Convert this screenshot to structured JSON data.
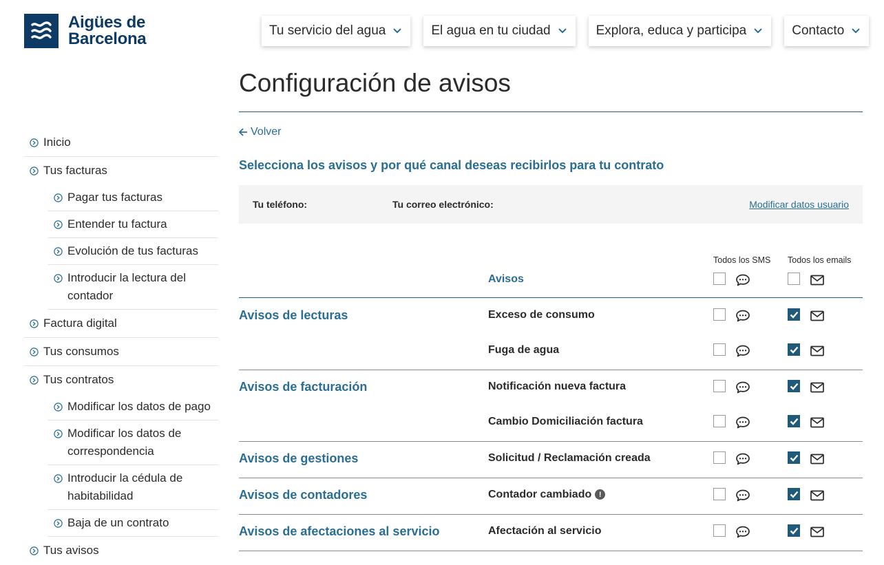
{
  "brand": {
    "line1": "Aigües de",
    "line2": "Barcelona",
    "color": "#0d3b66"
  },
  "topnav": [
    {
      "label": "Tu servicio del agua"
    },
    {
      "label": "El agua en tu ciudad"
    },
    {
      "label": "Explora, educa y participa"
    },
    {
      "label": "Contacto"
    }
  ],
  "sidebar": {
    "items": [
      {
        "label": "Inicio",
        "level": 0
      },
      {
        "label": "Tus facturas",
        "level": 0
      },
      {
        "label": "Pagar tus facturas",
        "level": 1
      },
      {
        "label": "Entender tu factura",
        "level": 1
      },
      {
        "label": "Evolución de tus facturas",
        "level": 1
      },
      {
        "label": "Introducir la lectura del contador",
        "level": 1
      },
      {
        "label": "Factura digital",
        "level": 0
      },
      {
        "label": "Tus consumos",
        "level": 0
      },
      {
        "label": "Tus contratos",
        "level": 0
      },
      {
        "label": "Modificar los datos de pago",
        "level": 1
      },
      {
        "label": "Modificar los datos de correspondencia",
        "level": 1
      },
      {
        "label": "Introducir la cédula de habitabilidad",
        "level": 1
      },
      {
        "label": "Baja de un contrato",
        "level": 1
      },
      {
        "label": "Tus avisos",
        "level": 0
      }
    ]
  },
  "main": {
    "title": "Configuración de avisos",
    "back_label": "Volver",
    "subtitle": "Selecciona los avisos y por qué canal deseas recibirlos para tu contrato",
    "user": {
      "phone_label": "Tu teléfono:",
      "email_label": "Tu correo electrónico:",
      "modify_label": "Modificar datos usuario"
    },
    "table": {
      "col_sms": "Todos los SMS",
      "col_email": "Todos los emails",
      "header_label": "Avisos",
      "header_sms_checked": false,
      "header_email_checked": false,
      "groups": [
        {
          "name": "Avisos de lecturas",
          "alerts": [
            {
              "name": "Exceso de consumo",
              "sms": false,
              "email": true,
              "info": false
            },
            {
              "name": "Fuga de agua",
              "sms": false,
              "email": true,
              "info": false
            }
          ]
        },
        {
          "name": "Avisos de facturación",
          "alerts": [
            {
              "name": "Notificación nueva factura",
              "sms": false,
              "email": true,
              "info": false
            },
            {
              "name": "Cambio Domiciliación factura",
              "sms": false,
              "email": true,
              "info": false
            }
          ]
        },
        {
          "name": "Avisos de gestiones",
          "alerts": [
            {
              "name": "Solicitud / Reclamación creada",
              "sms": false,
              "email": true,
              "info": false
            }
          ]
        },
        {
          "name": "Avisos de contadores",
          "alerts": [
            {
              "name": "Contador cambiado",
              "sms": false,
              "email": true,
              "info": true
            }
          ]
        },
        {
          "name": "Avisos de afectaciones al servicio",
          "alerts": [
            {
              "name": "Afectación al servicio",
              "sms": false,
              "email": true,
              "info": false
            }
          ]
        }
      ]
    }
  },
  "colors": {
    "accent": "#2a6e96",
    "checkbox_checked": "#1f5a7a"
  }
}
